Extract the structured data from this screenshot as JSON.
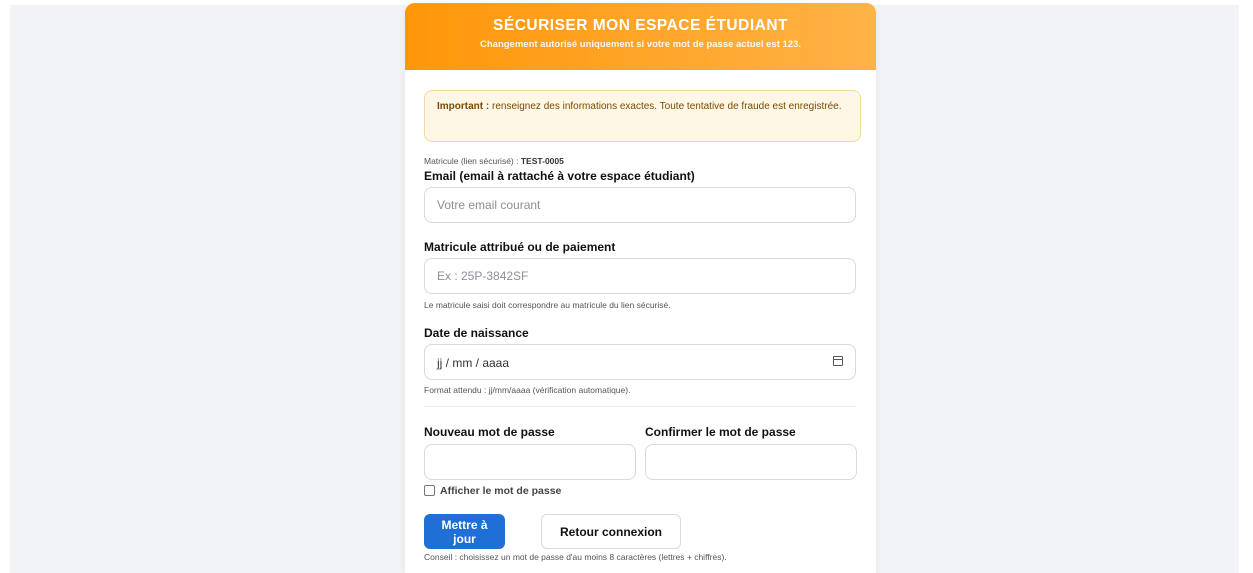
{
  "header": {
    "title": "SÉCURISER MON ESPACE ÉTUDIANT",
    "subtitle": "Changement autorisé uniquement si votre mot de passe actuel est 123."
  },
  "notice": {
    "bold": "Important :",
    "text": "renseignez des informations exactes. Toute tentative de fraude est enregistrée."
  },
  "matricule_link": {
    "label": "Matricule (lien sécurisé) :",
    "value": "TEST-0005"
  },
  "email": {
    "label": "Email (email à rattaché à votre espace étudiant)",
    "placeholder": "Votre email courant",
    "value": ""
  },
  "matricule": {
    "label": "Matricule attribué ou de paiement",
    "placeholder": "Ex : 25P-3842SF",
    "value": "",
    "hint": "Le matricule saisi doit correspondre au matricule du lien sécurisé."
  },
  "birthdate": {
    "label": "Date de naissance",
    "display": "jj / mm / aaaa",
    "hint": "Format attendu : jj/mm/aaaa (vérification automatique).",
    "icon": "calendar-icon"
  },
  "new_password": {
    "label": "Nouveau mot de passe",
    "value": ""
  },
  "confirm_password": {
    "label": "Confirmer le mot de passe",
    "value": ""
  },
  "show_password": {
    "label": "Afficher le mot de passe",
    "checked": false
  },
  "buttons": {
    "update": "Mettre à jour",
    "back": "Retour connexion"
  },
  "tip": "Conseil : choisissez un mot de passe d'au moins 8 caractères (lettres + chiffres).",
  "colors": {
    "header_start": "#ff9608",
    "header_end": "#ffb347",
    "primary": "#1f6fd6",
    "notice_bg": "#fff7e6"
  }
}
